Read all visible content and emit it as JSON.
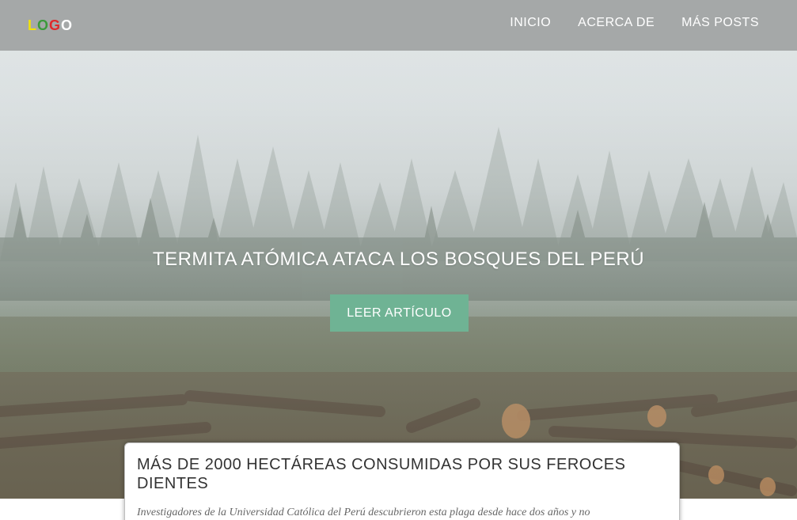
{
  "navbar": {
    "logo_letters": [
      {
        "char": "L",
        "color": "#f2e20a"
      },
      {
        "char": "O",
        "color": "#3b9a3b"
      },
      {
        "char": "G",
        "color": "#e0282a"
      },
      {
        "char": "O",
        "color": "#ffffff"
      }
    ],
    "links": [
      {
        "label": "INICIO"
      },
      {
        "label": "ACERCA DE"
      },
      {
        "label": "MÁS POSTS"
      }
    ]
  },
  "hero": {
    "title": "TERMITA ATÓMICA ATACA LOS BOSQUES DEL PERÚ",
    "cta_label": "LEER ARTÍCULO",
    "cta_color": "#6fb394",
    "image_icon": "foggy-forest-image"
  },
  "article": {
    "title": "MÁS DE 2000 HECTÁREAS CONSUMIDAS POR SUS FEROCES DIENTES",
    "excerpt": "Investigadores de la Universidad Católica del Perú descubrieron esta plaga desde hace dos años y no"
  }
}
